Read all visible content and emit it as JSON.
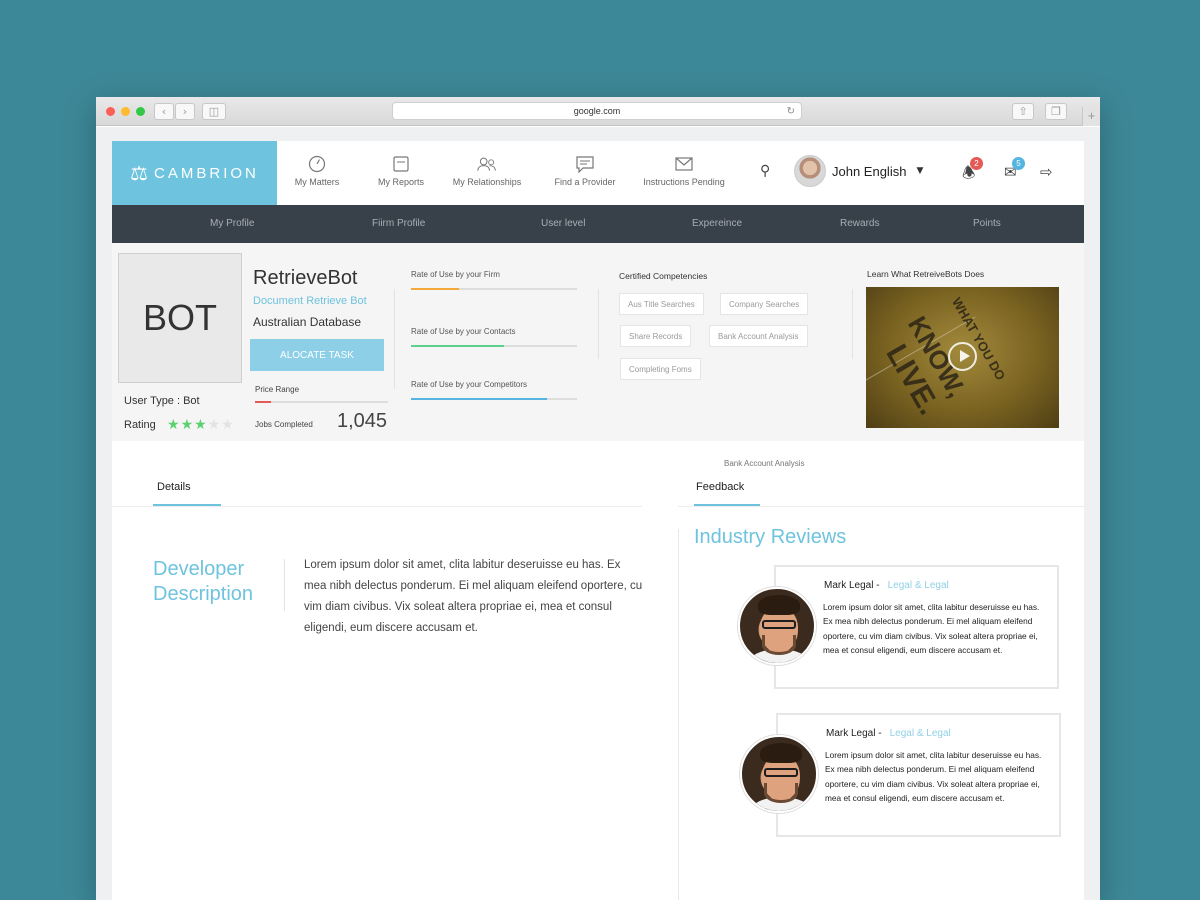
{
  "browser": {
    "url": "google.com"
  },
  "header": {
    "logo": "CAMBRION",
    "nav": [
      {
        "label": "My Matters",
        "icon": "gauge-icon"
      },
      {
        "label": "My Reports",
        "icon": "reports-icon"
      },
      {
        "label": "My Relationships",
        "icon": "people-icon"
      },
      {
        "label": "Find a Provider",
        "icon": "message-icon"
      },
      {
        "label": "Instructions Pending",
        "icon": "envelope-icon"
      }
    ],
    "user_name": "John English",
    "notifications_count": "2",
    "messages_count": "5",
    "accent": "#6ec3de"
  },
  "subnav": [
    "My Profile",
    "Fiirm Profile",
    "User level",
    "Expereince",
    "Rewards",
    "Points"
  ],
  "profile": {
    "box_text": "BOT",
    "name": "RetrieveBot",
    "subtitle": "Document Retrieve Bot",
    "database": "Australian Database",
    "allocate_label": "ALOCATE TASK",
    "price_label": "Price Range",
    "price_level": 0.12,
    "jobs_label": "Jobs Completed",
    "jobs_value": "1,045",
    "user_type": "User Type : Bot",
    "rating_label": "Rating",
    "rating": 3,
    "rating_max": 5
  },
  "rates": [
    {
      "label": "Rate of Use by your Firm",
      "fraction": 0.29,
      "color": "#f4a83a"
    },
    {
      "label": "Rate of Use by your Contacts",
      "fraction": 0.56,
      "color": "#5bd18b"
    },
    {
      "label": "Rate of Use by your Competitors",
      "fraction": 0.82,
      "color": "#55b5e0"
    }
  ],
  "competencies": {
    "title": "Certified Competencies",
    "items": [
      "Aus Title Searches",
      "Company Searches",
      "Share Records",
      "Bank Account Analysis",
      "Completing Foms"
    ]
  },
  "video": {
    "title": "Learn What RetreiveBots Does",
    "word1": "KNOW,",
    "word2": "LIVE.",
    "small": "WHAT YOU DO"
  },
  "tabs": {
    "floating_label": "Bank Account Analysis",
    "details": "Details",
    "feedback": "Feedback"
  },
  "details": {
    "title_line1": "Developer",
    "title_line2": "Description",
    "text": "Lorem ipsum dolor sit amet, clita labitur deseruisse eu has. Ex mea nibh delectus ponderum. Ei mel aliquam eleifend oportere, cu vim diam civibus. Vix soleat altera propriae ei, mea et consul eligendi, eum discere accusam et."
  },
  "reviews": {
    "title": "Industry Reviews",
    "items": [
      {
        "name": "Mark Legal -",
        "firm": "Legal & Legal",
        "text": "Lorem ipsum dolor sit amet, clita labitur deseruisse eu has. Ex mea nibh delectus ponderum. Ei mel aliquam eleifend oportere, cu vim diam civibus. Vix soleat altera propriae ei, mea et consul eligendi, eum discere accusam et."
      },
      {
        "name": "Mark Legal -",
        "firm": "Legal & Legal",
        "text": "Lorem ipsum dolor sit amet, clita labitur deseruisse eu has. Ex mea nibh delectus ponderum. Ei mel aliquam eleifend oportere, cu vim diam civibus. Vix soleat altera propriae ei, mea et consul eligendi, eum discere accusam et."
      }
    ]
  }
}
